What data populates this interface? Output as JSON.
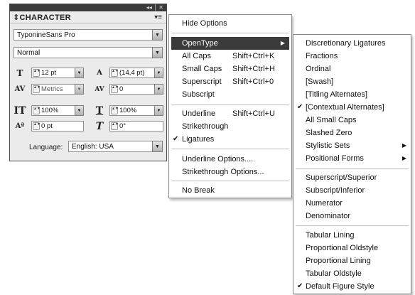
{
  "panel": {
    "title": "CHARACTER",
    "titlebar_controls": "◂◂ │ ✕",
    "menu_icon": "▾≡",
    "font_family": "TyponineSans Pro",
    "font_style": "Normal",
    "font_size": "12 pt",
    "leading": "(14,4 pt)",
    "kerning": "Metrics",
    "tracking": "0",
    "vertical_scale": "100%",
    "horizontal_scale": "100%",
    "baseline_shift": "0 pt",
    "skew": "0°",
    "language_label": "Language:",
    "language": "English: USA"
  },
  "main_menu": {
    "items": [
      {
        "label": "Hide Options",
        "shortcut": ""
      },
      {
        "label": "OpenType",
        "shortcut": "",
        "submenu": true,
        "highlighted": true
      },
      {
        "label": "All Caps",
        "shortcut": "Shift+Ctrl+K"
      },
      {
        "label": "Small Caps",
        "shortcut": "Shift+Ctrl+H"
      },
      {
        "label": "Superscript",
        "shortcut": "Shift+Ctrl+0"
      },
      {
        "label": "Subscript",
        "shortcut": ""
      },
      {
        "label": "Underline",
        "shortcut": "Shift+Ctrl+U"
      },
      {
        "label": "Strikethrough",
        "shortcut": ""
      },
      {
        "label": "Ligatures",
        "shortcut": "",
        "checked": true
      },
      {
        "label": "Underline Options....",
        "shortcut": ""
      },
      {
        "label": "Strikethrough Options...",
        "shortcut": ""
      },
      {
        "label": "No Break",
        "shortcut": ""
      }
    ]
  },
  "opentype_menu": {
    "items": [
      {
        "label": "Discretionary Ligatures"
      },
      {
        "label": "Fractions"
      },
      {
        "label": "Ordinal"
      },
      {
        "label": "[Swash]"
      },
      {
        "label": "[Titling Alternates]"
      },
      {
        "label": "[Contextual Alternates]",
        "checked": true
      },
      {
        "label": "All Small Caps"
      },
      {
        "label": "Slashed Zero"
      },
      {
        "label": "Stylistic Sets",
        "submenu": true
      },
      {
        "label": "Positional Forms",
        "submenu": true
      },
      {
        "label": "Superscript/Superior"
      },
      {
        "label": "Subscript/Inferior"
      },
      {
        "label": "Numerator"
      },
      {
        "label": "Denominator"
      },
      {
        "label": "Tabular Lining"
      },
      {
        "label": "Proportional Oldstyle"
      },
      {
        "label": "Proportional Lining"
      },
      {
        "label": "Tabular Oldstyle"
      },
      {
        "label": "Default Figure Style",
        "checked": true
      }
    ]
  },
  "glyphs": {
    "check": "✔",
    "submenu_arrow": "▶",
    "dropdown_arrow": "▼",
    "spin_arrows": "▲▼"
  }
}
